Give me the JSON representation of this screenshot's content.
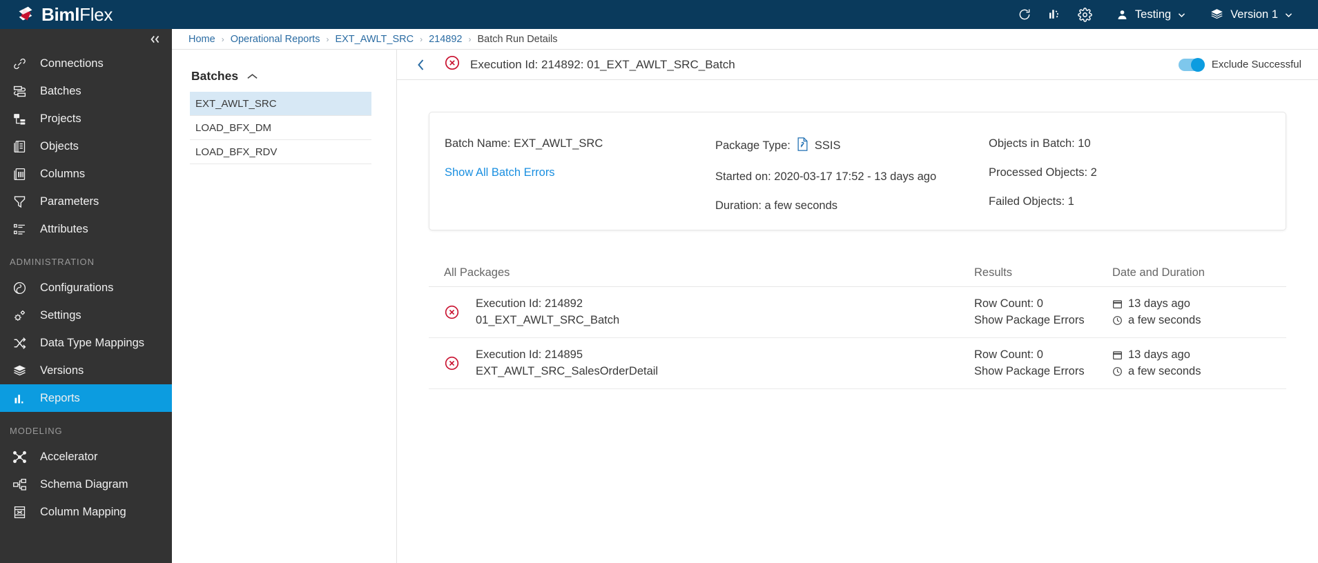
{
  "brand": {
    "bold": "Biml",
    "light": "Flex"
  },
  "topbar": {
    "icons": [
      {
        "name": "refresh-icon"
      },
      {
        "name": "analytics-icon"
      },
      {
        "name": "gear-icon"
      }
    ],
    "user_menu": {
      "label": "Testing",
      "icon": "user-icon"
    },
    "version_menu": {
      "label": "Version 1",
      "icon": "layers-icon"
    }
  },
  "sidebar": {
    "collapse_icon": "double-chevron-left-icon",
    "items": [
      {
        "label": "Connections",
        "icon": "link-icon",
        "active": false
      },
      {
        "label": "Batches",
        "icon": "batches-icon",
        "active": false
      },
      {
        "label": "Projects",
        "icon": "projects-icon",
        "active": false
      },
      {
        "label": "Objects",
        "icon": "objects-icon",
        "active": false
      },
      {
        "label": "Columns",
        "icon": "columns-icon",
        "active": false
      },
      {
        "label": "Parameters",
        "icon": "filter-icon",
        "active": false
      },
      {
        "label": "Attributes",
        "icon": "attributes-icon",
        "active": false
      }
    ],
    "section_administration": "ADMINISTRATION",
    "admin_items": [
      {
        "label": "Configurations",
        "icon": "configurations-icon",
        "active": false
      },
      {
        "label": "Settings",
        "icon": "settings-gears-icon",
        "active": false
      },
      {
        "label": "Data Type Mappings",
        "icon": "shuffle-icon",
        "active": false
      },
      {
        "label": "Versions",
        "icon": "layers-icon",
        "active": false
      },
      {
        "label": "Reports",
        "icon": "bar-chart-icon",
        "active": true
      }
    ],
    "section_modeling": "MODELING",
    "modeling_items": [
      {
        "label": "Accelerator",
        "icon": "nodes-icon",
        "active": false
      },
      {
        "label": "Schema Diagram",
        "icon": "schema-icon",
        "active": false
      },
      {
        "label": "Column Mapping",
        "icon": "mapping-icon",
        "active": false
      }
    ]
  },
  "breadcrumb": {
    "items": [
      "Home",
      "Operational Reports",
      "EXT_AWLT_SRC",
      "214892"
    ],
    "current": "Batch Run Details",
    "separator": "›"
  },
  "subheader": {
    "back_icon": "chevron-left-icon",
    "status_icon": "error-circle-icon",
    "title": "Execution Id: 214892: 01_EXT_AWLT_SRC_Batch",
    "toggle_label": "Exclude Successful",
    "toggle_on": true
  },
  "batches_panel": {
    "title": "Batches",
    "collapse_icon": "chevron-up-icon",
    "items": [
      {
        "label": "EXT_AWLT_SRC",
        "selected": true
      },
      {
        "label": "LOAD_BFX_DM",
        "selected": false
      },
      {
        "label": "LOAD_BFX_RDV",
        "selected": false
      }
    ]
  },
  "summary_card": {
    "batch_name": "Batch Name: EXT_AWLT_SRC",
    "show_all_batch_errors": "Show All Batch Errors",
    "package_type_label": "Package Type:",
    "package_type_icon": "ssis-file-icon",
    "package_type_value": "SSIS",
    "started_on": "Started on: 2020-03-17 17:52 - 13 days ago",
    "duration": "Duration: a few seconds",
    "objects_in_batch": "Objects in Batch: 10",
    "processed_objects": "Processed Objects: 2",
    "failed_objects": "Failed Objects: 1"
  },
  "packages_table": {
    "headers": {
      "packages": "All Packages",
      "results": "Results",
      "date": "Date and Duration"
    },
    "rows": [
      {
        "status_icon": "error-circle-icon",
        "exec_id": "Execution Id: 214892",
        "package_name": "01_EXT_AWLT_SRC_Batch",
        "row_count": "Row Count: 0",
        "errors_link": "Show Package Errors",
        "date": "13 days ago",
        "duration": "a few seconds",
        "date_icon": "calendar-icon",
        "duration_icon": "clock-icon"
      },
      {
        "status_icon": "error-circle-icon",
        "exec_id": "Execution Id: 214895",
        "package_name": "EXT_AWLT_SRC_SalesOrderDetail",
        "row_count": "Row Count: 0",
        "errors_link": "Show Package Errors",
        "date": "13 days ago",
        "duration": "a few seconds",
        "date_icon": "calendar-icon",
        "duration_icon": "clock-icon"
      }
    ]
  },
  "colors": {
    "brand_bar": "#0a3a5c",
    "sidebar": "#333333",
    "accent_blue": "#0c9ce0",
    "link_blue": "#1a8fe0",
    "error_red": "#c8102e",
    "selected_row": "#d7e8f5"
  }
}
